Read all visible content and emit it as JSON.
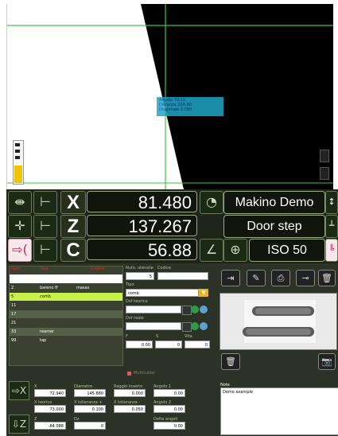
{
  "viewer": {
    "measure_lines": [
      "Angolo 70.11",
      "Distanza 200.90",
      "Diagonale 3.590"
    ]
  },
  "dro": {
    "rows": [
      {
        "axis": "X",
        "value": "81.480",
        "label": "Makino Demo"
      },
      {
        "axis": "Z",
        "value": "137.267",
        "label": "Door step"
      },
      {
        "axis": "C",
        "value": "56.88",
        "label": "ISO 50"
      }
    ]
  },
  "tools_table": {
    "headers": [
      "Num",
      "Tipo",
      "Codice"
    ],
    "rows": [
      {
        "num": "2",
        "tipo": "bareno ff",
        "codice": "masas",
        "style": "normal"
      },
      {
        "num": "5",
        "tipo": "comb",
        "codice": "",
        "style": "selected"
      },
      {
        "num": "11",
        "tipo": "",
        "codice": "",
        "style": "normal"
      },
      {
        "num": "17",
        "tipo": "",
        "codice": "",
        "style": "dark"
      },
      {
        "num": "21",
        "tipo": "",
        "codice": "",
        "style": "normal"
      },
      {
        "num": "33",
        "tipo": "reamer",
        "codice": "",
        "style": "dark"
      },
      {
        "num": "99",
        "tipo": "tap",
        "codice": "",
        "style": "normal"
      }
    ]
  },
  "tool_form": {
    "num_label": "Num. utensile",
    "codice_label": "Codice",
    "num_value": "5",
    "tipo_label": "Tipo",
    "tipo_value": "comb",
    "dxf_teorico_label": "Dxf teorico",
    "dxf_reale_label": "Dxf reale",
    "f_label": "F",
    "s_label": "S",
    "vita_label": "Vita",
    "f_value": "0.00",
    "s_value": "0",
    "vita_value": "0",
    "multicutter_label": "Multicutter"
  },
  "offsets": {
    "x_label": "X",
    "x_value": "72.940",
    "diametro_label": "Diametro",
    "diametro_value": "145.880",
    "raggio_label": "Raggio inserto",
    "raggio_value": "0.000",
    "angolo1_label": "Angolo 1",
    "angolo1_value": "0.00",
    "xteorico_label": "X teorico",
    "xteorico_value": "73.000",
    "xtoll_p_label": "X tolleranza +",
    "xtoll_p_value": "0.100",
    "xtoll_m_label": "X tolleranza -",
    "xtoll_m_value": "0.050",
    "angolo2_label": "Angolo 2",
    "angolo2_value": "0.00",
    "z_label": "Z",
    "z_value": "-84.088",
    "dz_label": "Dz",
    "dz_value": "0",
    "delta_label": "Delta angoli",
    "delta_value": "0.00"
  },
  "note": {
    "label": "Note",
    "text": "Demo example"
  }
}
